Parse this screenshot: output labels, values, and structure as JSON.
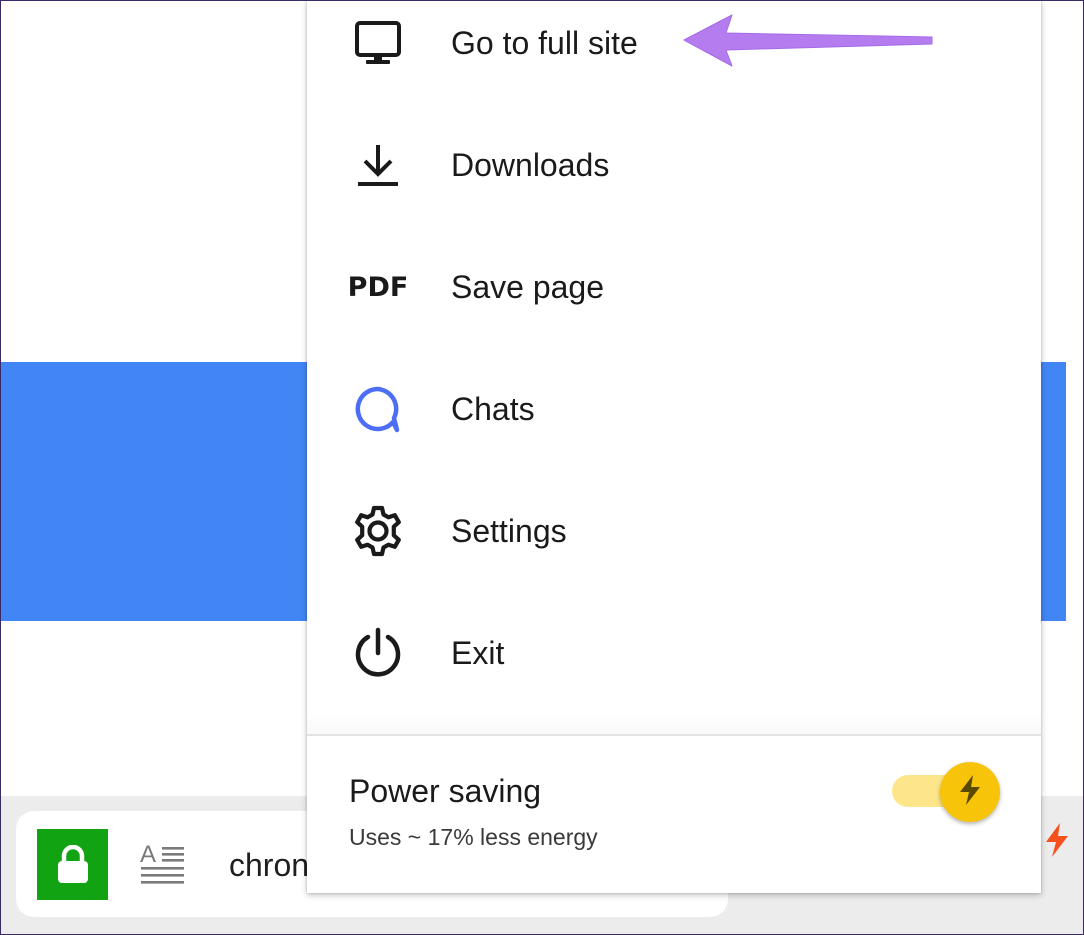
{
  "menu": {
    "items": [
      {
        "id": "full-site",
        "label": "Go to full site",
        "icon": "monitor-icon"
      },
      {
        "id": "downloads",
        "label": "Downloads",
        "icon": "download-icon"
      },
      {
        "id": "save-page",
        "label": "Save page",
        "icon": "pdf-icon",
        "icon_text": "PDF"
      },
      {
        "id": "chats",
        "label": "Chats",
        "icon": "chat-bubble-icon"
      },
      {
        "id": "settings",
        "label": "Settings",
        "icon": "gear-icon"
      },
      {
        "id": "exit",
        "label": "Exit",
        "icon": "power-icon"
      }
    ],
    "power_saving": {
      "title": "Power saving",
      "subtitle": "Uses ~ 17% less energy",
      "enabled": true,
      "icon": "lightning-bolt-icon"
    }
  },
  "address_bar": {
    "url_partial": "chron",
    "lock_icon": "lock-icon",
    "reader_icon": "reader-mode-icon",
    "turbo_icon": "turbo-bolt-icon"
  },
  "colors": {
    "banner": "#4285f4",
    "lock_bg": "#12a312",
    "chat_accent": "#4c6ef5",
    "toggle_knob": "#f7c40a",
    "toggle_track": "#fde68a",
    "annotation_arrow": "#b57cf0",
    "turbo_bolt": "#f4511e"
  },
  "annotation": {
    "type": "arrow",
    "points_to": "full-site"
  }
}
